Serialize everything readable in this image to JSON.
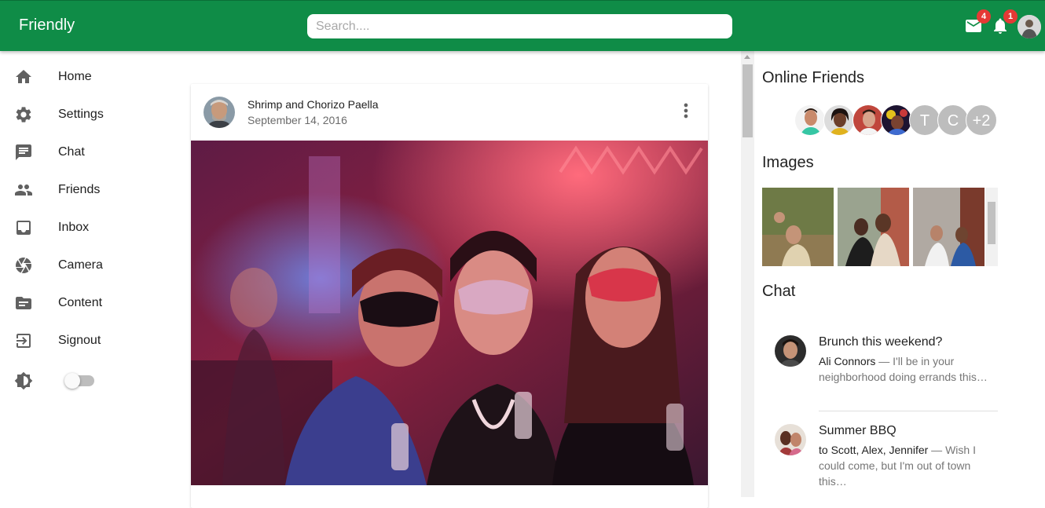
{
  "appbar": {
    "brand": "Friendly",
    "search_placeholder": "Search....",
    "mail_badge": "4",
    "notifications_badge": "1",
    "icons": [
      "mail-icon",
      "bell-icon",
      "account-avatar"
    ]
  },
  "sidebar": {
    "items": [
      {
        "label": "Home",
        "icon": "home-icon"
      },
      {
        "label": "Settings",
        "icon": "gear-icon"
      },
      {
        "label": "Chat",
        "icon": "chat-icon"
      },
      {
        "label": "Friends",
        "icon": "people-icon"
      },
      {
        "label": "Inbox",
        "icon": "inbox-icon"
      },
      {
        "label": "Camera",
        "icon": "camera-icon"
      },
      {
        "label": "Content",
        "icon": "folder-icon"
      },
      {
        "label": "Signout",
        "icon": "signout-icon"
      }
    ],
    "theme_toggle": {
      "icon": "brightness-icon",
      "on": false
    }
  },
  "post": {
    "title": "Shrimp and Chorizo Paella",
    "date": "September 14, 2016",
    "menu_icon": "more-vert-icon"
  },
  "online_friends": {
    "heading": "Online Friends",
    "letters": [
      "T",
      "C",
      "+2"
    ]
  },
  "images": {
    "heading": "Images"
  },
  "chat": {
    "heading": "Chat",
    "items": [
      {
        "title": "Brunch this weekend?",
        "from": "Ali Connors",
        "preview": " — I'll be in your neighborhood doing errands this…"
      },
      {
        "title": "Summer BBQ",
        "from": "to Scott, Alex, Jennifer",
        "preview": " — Wish I could come, but I'm out of town this…"
      }
    ]
  },
  "colors": {
    "primary": "#0f8c47",
    "badge": "#e53935",
    "letter_avatar": "#bdbdbd"
  }
}
